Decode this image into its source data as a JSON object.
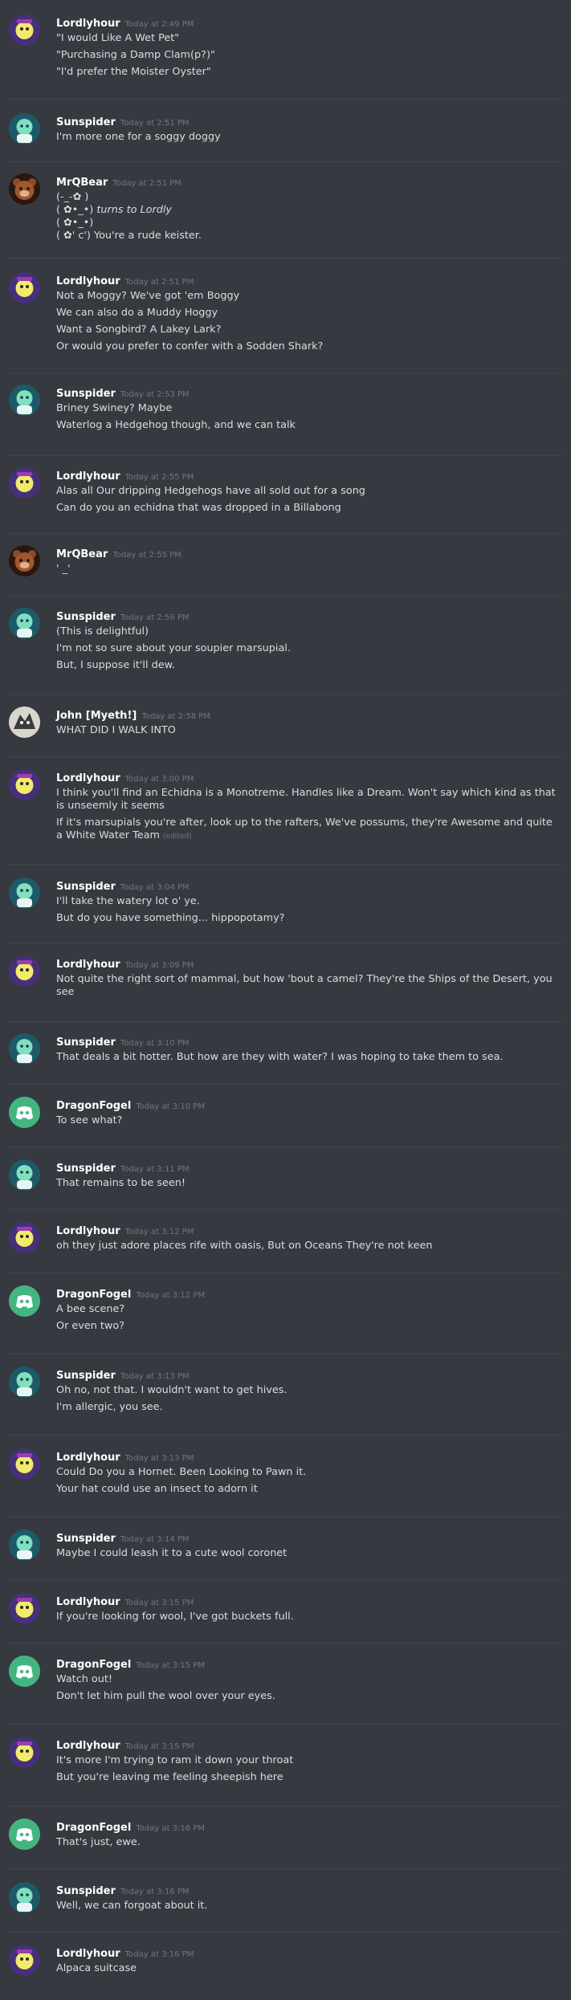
{
  "messages": [
    {
      "author": "Lordlyhour",
      "avatar": "lordlyhour-avatar",
      "time": "Today at 2:49 PM",
      "lines": [
        "\"I would Like A Wet Pet\"",
        "\"Purchasing a Damp Clam(p?)\"",
        "\"I'd prefer the Moister Oyster\""
      ]
    },
    {
      "author": "Sunspider",
      "avatar": "sunspider-avatar",
      "time": "Today at 2:51 PM",
      "lines": [
        "I'm more one for a soggy doggy"
      ]
    },
    {
      "author": "MrQBear",
      "avatar": "mrqbear-avatar",
      "time": "Today at 2:51 PM",
      "lines": [
        "(-_-✿ )",
        "( ✿•_•)",
        "( ✿•_•)",
        "( ✿' c') You're a rude keister."
      ],
      "emote": "turns to Lordly"
    },
    {
      "author": "Lordlyhour",
      "avatar": "lordlyhour-avatar",
      "time": "Today at 2:51 PM",
      "lines": [
        "Not a Moggy? We've got 'em Boggy",
        "We can also do a Muddy Hoggy",
        "Want a Songbird? A Lakey Lark?",
        "Or would you prefer to confer with a Sodden Shark?"
      ]
    },
    {
      "author": "Sunspider",
      "avatar": "sunspider-avatar",
      "time": "Today at 2:53 PM",
      "lines": [
        "Briney Swiney? Maybe",
        "Waterlog a Hedgehog though, and we can talk"
      ]
    },
    {
      "author": "Lordlyhour",
      "avatar": "lordlyhour-avatar",
      "time": "Today at 2:55 PM",
      "lines": [
        "Alas all Our dripping Hedgehogs have all sold out for a song",
        "Can do you an echidna that was dropped in a Billabong"
      ]
    },
    {
      "author": "MrQBear",
      "avatar": "mrqbear-avatar",
      "time": "Today at 2:55 PM",
      "lines": [
        "' _'"
      ]
    },
    {
      "author": "Sunspider",
      "avatar": "sunspider-avatar",
      "time": "Today at 2:56 PM",
      "lines": [
        "(This is delightful)",
        "I'm not so sure about your soupier marsupial.",
        "But, I suppose it'll dew."
      ]
    },
    {
      "author": "John [Myeth!]",
      "avatar": "john-avatar",
      "time": "Today at 2:58 PM",
      "lines": [
        "WHAT DID I WALK INTO"
      ]
    },
    {
      "author": "Lordlyhour",
      "avatar": "lordlyhour-avatar",
      "time": "Today at 3:00 PM",
      "lines": [
        "I think you'll find an Echidna is a Monotreme. Handles like a Dream. Won't say which kind as that is unseemly it seems",
        "If it's marsupials you're after, look up to the rafters, We've possums, they're Awesome and quite a White Water Team"
      ],
      "edited": "(edited)"
    },
    {
      "author": "Sunspider",
      "avatar": "sunspider-avatar",
      "time": "Today at 3:04 PM",
      "lines": [
        "I'll take the watery lot o' ye.",
        "But do you have something... hippopotamy?"
      ]
    },
    {
      "author": "Lordlyhour",
      "avatar": "lordlyhour-avatar",
      "time": "Today at 3:09 PM",
      "lines": [
        "Not quite the right sort of mammal, but how 'bout a camel? They're the Ships of the Desert, you see"
      ]
    },
    {
      "author": "Sunspider",
      "avatar": "sunspider-avatar",
      "time": "Today at 3:10 PM",
      "lines": [
        "That deals a bit hotter. But how are they with water? I was hoping to take them to sea."
      ]
    },
    {
      "author": "DragonFogel",
      "avatar": "dragonfogel-avatar",
      "time": "Today at 3:10 PM",
      "lines": [
        "To see what?"
      ]
    },
    {
      "author": "Sunspider",
      "avatar": "sunspider-avatar",
      "time": "Today at 3:11 PM",
      "lines": [
        "That remains to be seen!"
      ]
    },
    {
      "author": "Lordlyhour",
      "avatar": "lordlyhour-avatar",
      "time": "Today at 3:12 PM",
      "lines": [
        "oh they just adore places rife with oasis, But on Oceans They're not keen"
      ]
    },
    {
      "author": "DragonFogel",
      "avatar": "dragonfogel-avatar",
      "time": "Today at 3:12 PM",
      "lines": [
        "A bee scene?",
        "Or even two?"
      ]
    },
    {
      "author": "Sunspider",
      "avatar": "sunspider-avatar",
      "time": "Today at 3:13 PM",
      "lines": [
        "Oh no, not that. I wouldn't want to get hives.",
        "I'm allergic, you see."
      ]
    },
    {
      "author": "Lordlyhour",
      "avatar": "lordlyhour-avatar",
      "time": "Today at 3:13 PM",
      "lines": [
        "Could Do you a Hornet. Been Looking to Pawn it.",
        "Your hat could use an insect to adorn it"
      ]
    },
    {
      "author": "Sunspider",
      "avatar": "sunspider-avatar",
      "time": "Today at 3:14 PM",
      "lines": [
        "Maybe I could leash it to a cute wool coronet"
      ]
    },
    {
      "author": "Lordlyhour",
      "avatar": "lordlyhour-avatar",
      "time": "Today at 3:15 PM",
      "lines": [
        "If you're looking for wool, I've got buckets full."
      ]
    },
    {
      "author": "DragonFogel",
      "avatar": "dragonfogel-avatar",
      "time": "Today at 3:15 PM",
      "lines": [
        "Watch out!",
        "Don't let him pull the wool over your eyes."
      ]
    },
    {
      "author": "Lordlyhour",
      "avatar": "lordlyhour-avatar",
      "time": "Today at 3:15 PM",
      "lines": [
        "It's more I'm trying to ram it down your throat",
        "But you're leaving me feeling sheepish here"
      ]
    },
    {
      "author": "DragonFogel",
      "avatar": "dragonfogel-avatar",
      "time": "Today at 3:16 PM",
      "lines": [
        "That's just, ewe."
      ]
    },
    {
      "author": "Sunspider",
      "avatar": "sunspider-avatar",
      "time": "Today at 3:16 PM",
      "lines": [
        "Well, we can forgoat about it."
      ]
    },
    {
      "author": "Lordlyhour",
      "avatar": "lordlyhour-avatar",
      "time": "Today at 3:16 PM",
      "lines": [
        "Alpaca suitcase"
      ]
    }
  ],
  "colors": {
    "background": "#36393f",
    "text": "#dcddde",
    "username": "#ffffff",
    "timestamp": "#72767d",
    "divider": "#40444b"
  }
}
